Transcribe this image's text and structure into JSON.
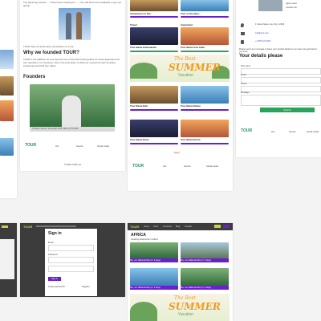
{
  "about": {
    "breadcrumb": "Trip planning process → Travel lovers looking for ... › You will find tours worldwide to get you going!",
    "photo_caption": "TOUR Team at local party somewhere on a trip",
    "why_heading": "Why we founded TOUR?",
    "why_text": "TOUR is the platform for tour tips and one of the best travel guides for travel agencies and tour operators. For travelers, this is the best place to discover a great trip with amazing experience and find tour offers.",
    "founders_heading": "Founders",
    "founder_caption": "Charlie Jones, Founder and CEO of TOUR",
    "footer_cols": [
      "Info",
      "Service",
      "Social media"
    ],
    "copyright": "© 2021 TOUR Ltd."
  },
  "listing": {
    "top_cards": [
      "Adventures in Slo...",
      "Tour of the Alps..."
    ],
    "section_left": "Travel",
    "section_right": "Inspiration",
    "cards": [
      {
        "title": "Tour Name Kathmandu",
        "price": "$299"
      },
      {
        "title": "Tour Name Goa India",
        "price": "$399"
      },
      {
        "title": "Tour Name Bali",
        "price": "$459"
      },
      {
        "title": "Tour Name Dubai",
        "price": "$599"
      },
      {
        "title": "Tour Name Paris",
        "price": "$299"
      },
      {
        "title": "Tour Name Rome",
        "price": "$349"
      }
    ],
    "banner_line1": "The Best",
    "banner_line2": "SUMMER",
    "banner_line3": "Vacation",
    "more_label": "More",
    "footer_cols": [
      "Info",
      "Service",
      "Social media"
    ]
  },
  "contact": {
    "agent_lines": [
      "Agent name",
      "Contact info"
    ],
    "address": "1 Street Name, Any City, 12345",
    "email": "info@tour.com",
    "phone": "+1 555 123 4567",
    "intro": "Please send us a message or leave your contact details so our team can get back to you soon.",
    "form_title": "Your details please",
    "fields": [
      "First name",
      "Email",
      "Phone",
      "Message"
    ],
    "submit_label": "Submit",
    "footer_cols": [
      "Info",
      "Service",
      "Social media"
    ]
  },
  "signin": {
    "title": "Sign in",
    "email_label": "Email",
    "password_label": "Password",
    "button_label": "Sign in",
    "forgot": "Forgot password?",
    "register": "Register"
  },
  "africa": {
    "menu": [
      "Home",
      "Tours",
      "Countries",
      "Blog",
      "Contact"
    ],
    "title": "AFRICA",
    "subtitle": "Amazing adventures in Africa",
    "cards": [
      "Ma...sur National Park (2 / 2 days)",
      "Ma...sur National Park (2 / 2 days)",
      "Ma...sur National Park (2 / 2 days)",
      "Ma...sur National Park (2 / 2 days)"
    ],
    "banner_line1": "The Best",
    "banner_line2": "SUMMER",
    "banner_line3": "Vacation"
  },
  "colors": {
    "accent": "#6a1fd1",
    "green": "#27a45a",
    "dark": "#3c3c3c",
    "orange": "#f29b1f"
  }
}
